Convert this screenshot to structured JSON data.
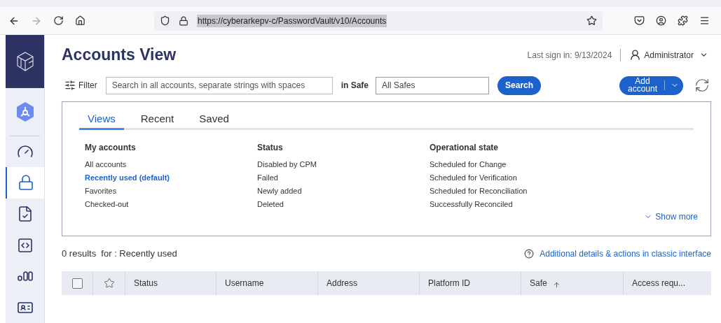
{
  "browser": {
    "url": "https://cyberarkepv-c/PasswordVault/v10/Accounts",
    "forward_disabled": true
  },
  "sidebar": {
    "items": [
      {
        "kind": "hub",
        "selected": false
      },
      {
        "kind": "gauge",
        "selected": false
      },
      {
        "kind": "lock",
        "selected": true
      },
      {
        "kind": "report",
        "selected": false
      },
      {
        "kind": "code",
        "selected": false
      },
      {
        "kind": "bars",
        "selected": false
      },
      {
        "kind": "card",
        "selected": false
      }
    ]
  },
  "page": {
    "title": "Accounts View",
    "last_sign_in": "Last sign in: 9/13/2024",
    "user": "Administrator"
  },
  "filter_bar": {
    "filter_label": "Filter",
    "search_placeholder": "Search in all accounts, separate strings with spaces",
    "safe_label": "in Safe",
    "safe_value": "All Safes",
    "search_button": "Search",
    "add_button": "Add account"
  },
  "filter_panel": {
    "tabs": [
      {
        "label": "Views",
        "selected": true
      },
      {
        "label": "Recent",
        "selected": false
      },
      {
        "label": "Saved",
        "selected": false
      }
    ],
    "groups": [
      {
        "heading": "My accounts",
        "items": [
          {
            "label": "All accounts",
            "selected": false
          },
          {
            "label": "Recently used (default)",
            "selected": true
          },
          {
            "label": "Favorites",
            "selected": false
          },
          {
            "label": "Checked-out",
            "selected": false
          }
        ]
      },
      {
        "heading": "Status",
        "items": [
          {
            "label": "Disabled by CPM",
            "selected": false
          },
          {
            "label": "Failed",
            "selected": false
          },
          {
            "label": "Newly added",
            "selected": false
          },
          {
            "label": "Deleted",
            "selected": false
          }
        ]
      },
      {
        "heading": "Operational state",
        "items": [
          {
            "label": "Scheduled for Change",
            "selected": false
          },
          {
            "label": "Scheduled for Verification",
            "selected": false
          },
          {
            "label": "Scheduled for Reconciliation",
            "selected": false
          },
          {
            "label": "Successfully Reconciled",
            "selected": false
          }
        ]
      }
    ],
    "show_more": "Show more"
  },
  "results": {
    "summary": "0 results  for : Recently used",
    "classic_link": "Additional details & actions in classic interface"
  },
  "table": {
    "select_all_checked": false,
    "columns": [
      {
        "label": "Status",
        "sorted": false
      },
      {
        "label": "Username",
        "sorted": false
      },
      {
        "label": "Address",
        "sorted": false
      },
      {
        "label": "Platform ID",
        "sorted": false
      },
      {
        "label": "Safe",
        "sorted": true
      },
      {
        "label": "Access requ...",
        "sorted": false
      }
    ]
  }
}
